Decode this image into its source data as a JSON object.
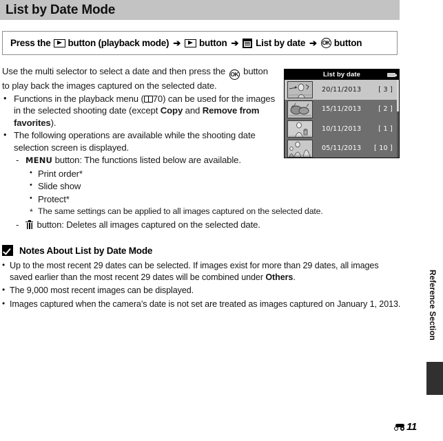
{
  "header": {
    "title": "List by Date Mode"
  },
  "nav_path": {
    "lead": "Press the",
    "playback_icon": "playback-icon",
    "seg1": "button (playback mode)",
    "arrow": "➔",
    "seg2": "button",
    "list_by_date_icon": "calendar-icon",
    "seg3": "List by date",
    "ok_icon": "ok-button-icon",
    "seg4": "button"
  },
  "body": {
    "intro_a": "Use the multi selector to select a date and then press the",
    "intro_ok_icon": "ok-button-icon",
    "intro_b": "button to play back the images captured on the selected date.",
    "bullet1_a": "Functions in the playback menu (",
    "bullet1_ref_icon": "book-reference-icon",
    "bullet1_ref_page": "70",
    "bullet1_b": ") can be used for the images in the selected shooting date (except",
    "bullet1_bold1": "Copy",
    "bullet1_c": "and",
    "bullet1_bold2": "Remove from favorites",
    "bullet1_d": ").",
    "bullet2": "The following operations are available while the shooting date selection screen is displayed.",
    "menu_icon_label": "MENU",
    "menu_line": "button: The functions listed below are available.",
    "menu_options": [
      "Print order*",
      "Slide show",
      "Protect*"
    ],
    "star_note": "The same settings can be applied to all images captured on the selected date.",
    "trash_icon": "trash-icon",
    "trash_line": "button: Deletes all images captured on the selected date."
  },
  "lcd": {
    "title": "List by date",
    "battery_icon": "battery-icon",
    "rows": [
      {
        "date": "20/11/2013",
        "count": "[    3 ]",
        "selected": true,
        "thumb": "thumbnail-photo-1"
      },
      {
        "date": "15/11/2013",
        "count": "[    2 ]",
        "selected": false,
        "thumb": "thumbnail-photo-2"
      },
      {
        "date": "10/11/2013",
        "count": "[    1 ]",
        "selected": false,
        "thumb": "thumbnail-photo-3"
      },
      {
        "date": "05/11/2013",
        "count": "[  10 ]",
        "selected": false,
        "thumb": "thumbnail-photo-4"
      }
    ]
  },
  "notes": {
    "icon": "check-mark-icon",
    "title": "Notes About List by Date Mode",
    "items": [
      {
        "pre": "Up to the most recent 29 dates can be selected. If images exist for more than 29 dates, all images saved earlier than the most recent 29 dates will be combined under",
        "bold": "Others",
        "post": "."
      },
      {
        "pre": "The 9,000 most recent images can be displayed.",
        "bold": "",
        "post": ""
      },
      {
        "pre": "Images captured when the camera’s date is not set are treated as images captured on January 1, 2013.",
        "bold": "",
        "post": ""
      }
    ]
  },
  "side": {
    "label": "Reference Section",
    "tab": "section-tab-marker"
  },
  "footer": {
    "section_icon": "reference-section-icon",
    "page_number": "11"
  },
  "colors": {
    "title_bar": "#c3c3c3",
    "lcd_background": "#6e6e6e",
    "lcd_header": "#000000",
    "lcd_selected_row": "#c8c8c8",
    "side_tab": "#303030"
  }
}
